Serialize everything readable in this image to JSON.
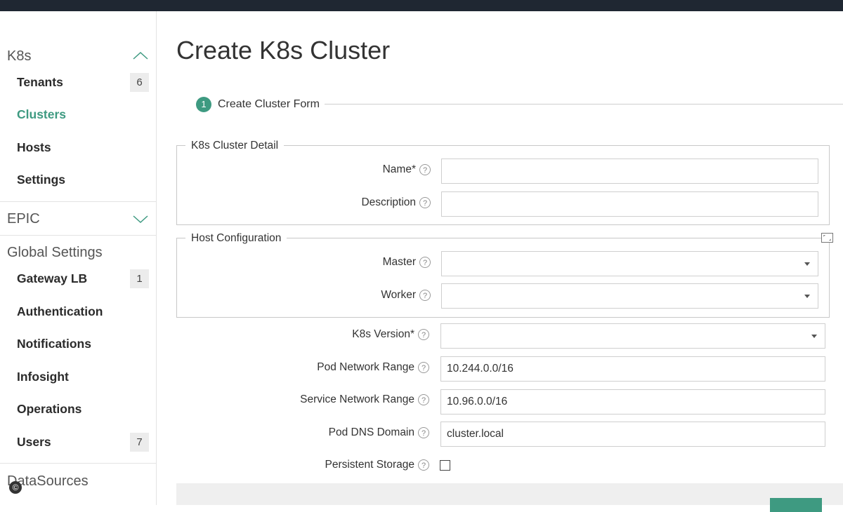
{
  "sidebar": {
    "sections": {
      "k8s": {
        "title": "K8s",
        "expanded": true,
        "chevron_icon": "chevron-up-icon"
      },
      "epic": {
        "title": "EPIC",
        "expanded": false,
        "chevron_icon": "chevron-down-icon"
      },
      "global_settings": {
        "title": "Global Settings"
      },
      "datasources": {
        "title": "DataSources"
      }
    },
    "k8s_items": [
      {
        "label": "Tenants",
        "badge": "6"
      },
      {
        "label": "Clusters",
        "active": true
      },
      {
        "label": "Hosts"
      },
      {
        "label": "Settings"
      }
    ],
    "global_items": [
      {
        "label": "Gateway LB",
        "badge": "1"
      },
      {
        "label": "Authentication"
      },
      {
        "label": "Notifications"
      },
      {
        "label": "Infosight"
      },
      {
        "label": "Operations"
      },
      {
        "label": "Users",
        "badge": "7"
      }
    ],
    "copyright_icon": "copyright-icon",
    "copyright_symbol": "©"
  },
  "page": {
    "title": "Create K8s Cluster"
  },
  "wizard": {
    "step_number": "1",
    "step_label": "Create Cluster Form"
  },
  "form": {
    "help_symbol": "?",
    "cluster_detail": {
      "legend": "K8s Cluster Detail",
      "name_label": "Name*",
      "name_value": "",
      "description_label": "Description",
      "description_value": ""
    },
    "host_config": {
      "legend": "Host Configuration",
      "master_label": "Master",
      "master_value": "",
      "worker_label": "Worker",
      "worker_value": ""
    },
    "k8s_version_label": "K8s Version*",
    "k8s_version_value": "",
    "pod_network_label": "Pod Network Range",
    "pod_network_value": "10.244.0.0/16",
    "service_network_label": "Service Network Range",
    "service_network_value": "10.96.0.0/16",
    "pod_dns_label": "Pod DNS Domain",
    "pod_dns_value": "cluster.local",
    "persistent_storage_label": "Persistent Storage",
    "persistent_storage_checked": false
  },
  "colors": {
    "accent": "#3e9a81",
    "topbar": "#1f2732"
  }
}
